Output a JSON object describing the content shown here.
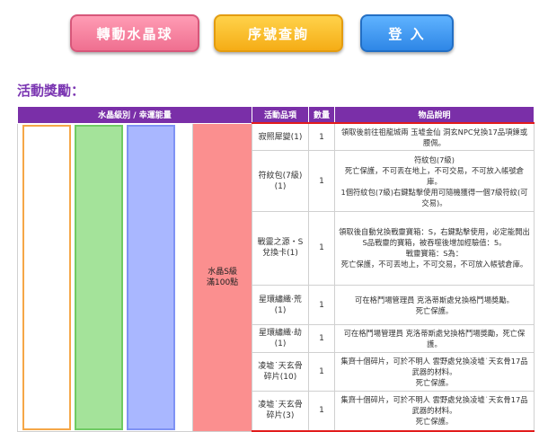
{
  "buttons": {
    "crystal": "轉動水晶球",
    "serial": "序號查詢",
    "login": "登 入"
  },
  "section_title": "活動獎勵：",
  "table": {
    "headers": {
      "level": "水晶級別 / 幸運能量",
      "item": "活動品項",
      "qty": "數量",
      "desc": "物品說明"
    },
    "crystal_label": "水晶S級\n滿100點",
    "rows": [
      {
        "item": "寂照犀變(1)",
        "qty": "1",
        "desc": "領取後前往祖龍城兩 玉墟金仙 洞玄NPC兌換17品項鍊或腰佩。"
      },
      {
        "item": "符紋包(7級)(1)",
        "qty": "1",
        "desc": "符紋包(7級)\n死亡保護，不可丟在地上，不可交易，不可放入帳號倉庫。\n1個符紋包(7級)右鍵點擊使用可隨機獲得一個7級符紋(可交易)。"
      },
      {
        "item": "戰靈之源・S兌換卡(1)",
        "qty": "1",
        "desc": "領取後自動兌換戰靈寶箱：S，右鍵點擊使用，必定能開出S品戰靈的寶箱，被吞噬後增加經驗值：5。\n戰靈寶箱：S為：\n死亡保護，不可丟地上，不可交易，不可放入帳號倉庫。"
      },
      {
        "item": "星環繡織·荒(1)",
        "qty": "1",
        "desc": "可在格鬥場管理員 克洛蒂斯處兌換格鬥場獎勵。\n死亡保護。"
      },
      {
        "item": "星環繡織·劫(1)",
        "qty": "1",
        "desc": "可在格鬥場管理員 克洛蒂斯處兌換格鬥場獎勵，死亡保護。"
      },
      {
        "item": "凌墟˙天玄骨碎片(10)",
        "qty": "1",
        "desc": "集齊十個碎片，可於不明人 雲野處兌換凌墟˙天玄骨17品武器的材料。\n死亡保護。"
      },
      {
        "item": "凌墟˙天玄骨碎片(3)",
        "qty": "1",
        "desc": "集齊十個碎片，可於不明人 雲野處兌換凌墟˙天玄骨17品武器的材料。\n死亡保護。"
      }
    ]
  }
}
